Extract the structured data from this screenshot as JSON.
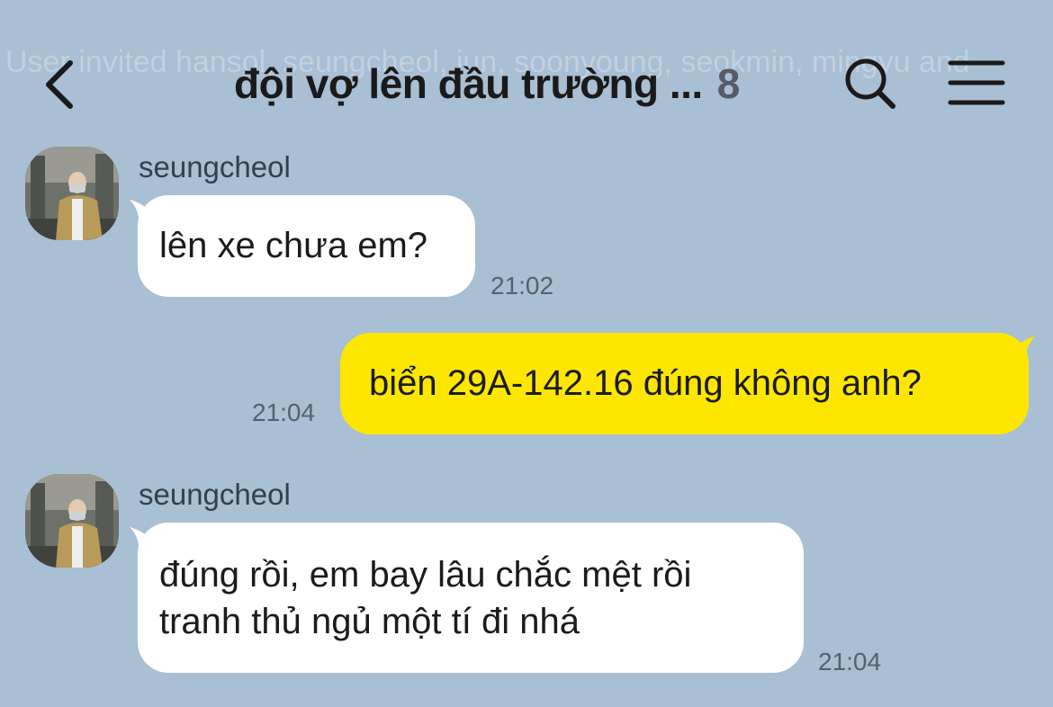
{
  "system_banner": "User invited hansol, seungcheol, jun, soonyoung, seokmin, mingyu and",
  "header": {
    "title": "đội vợ lên đầu trường ...",
    "member_count": "8"
  },
  "messages": [
    {
      "direction": "incoming",
      "sender": "seungcheol",
      "lines": [
        "lên xe chưa em?"
      ],
      "time": "21:02"
    },
    {
      "direction": "outgoing",
      "lines": [
        "biển 29A-142.16 đúng không anh?"
      ],
      "time": "21:04"
    },
    {
      "direction": "incoming",
      "sender": "seungcheol",
      "lines": [
        "đúng rồi, em bay lâu chắc mệt rồi",
        "tranh thủ ngủ một tí đi nhá"
      ],
      "time": "21:04"
    }
  ],
  "colors": {
    "background": "#a9bfd3",
    "incoming_bubble": "#ffffff",
    "outgoing_bubble": "#fde700"
  },
  "icons": {
    "back": "chevron-left-icon",
    "search": "search-icon",
    "menu": "hamburger-menu-icon"
  }
}
